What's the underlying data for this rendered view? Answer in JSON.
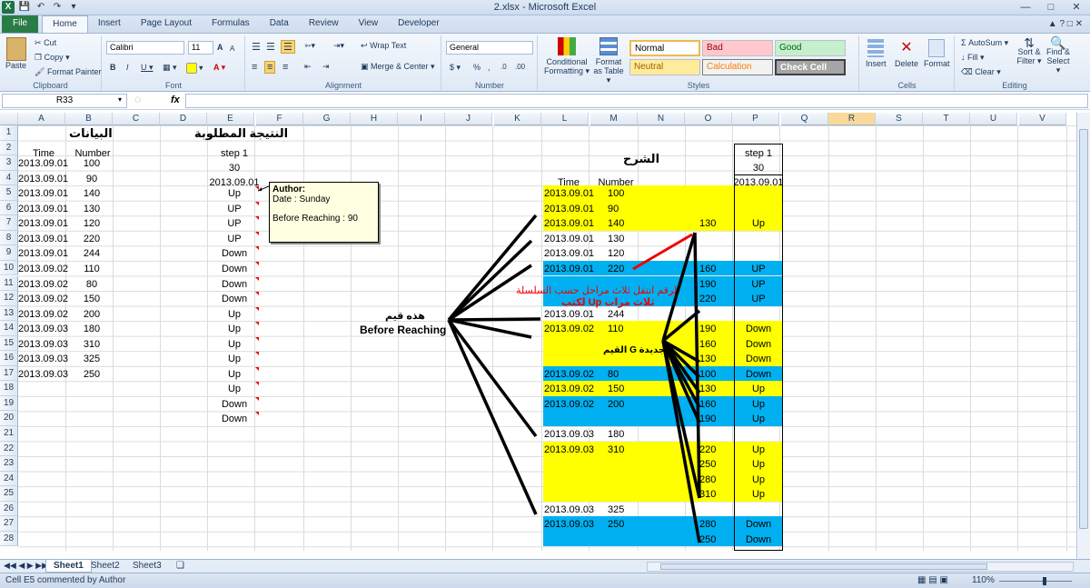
{
  "window": {
    "title": "2.xlsx  -  Microsoft Excel",
    "qat": [
      "X",
      "save",
      "undo",
      "redo",
      "▾"
    ]
  },
  "tabs": [
    "File",
    "Home",
    "Insert",
    "Page Layout",
    "Formulas",
    "Data",
    "Review",
    "View",
    "Developer"
  ],
  "ribbon": {
    "clipboard": {
      "paste": "Paste",
      "cut": "Cut",
      "copy": "Copy ▾",
      "format_painter": "Format Painter",
      "label": "Clipboard"
    },
    "font": {
      "name": "Calibri",
      "size": "11",
      "label": "Font",
      "bold": "B",
      "italic": "I",
      "underline": "U ▾",
      "grow": "A",
      "shrink": "A"
    },
    "alignment": {
      "wrap": "Wrap Text",
      "merge": "Merge & Center ▾",
      "label": "Alignment"
    },
    "number": {
      "format": "General",
      "label": "Number",
      "currency": "$ ▾",
      "percent": "%",
      "comma": ",",
      "inc_dec": ".0",
      "dec_dec": ".00"
    },
    "styles": {
      "conditional": "Conditional Formatting ▾",
      "format_table": "Format as Table ▾",
      "normal": "Normal",
      "bad": "Bad",
      "good": "Good",
      "neutral": "Neutral",
      "calculation": "Calculation",
      "check": "Check Cell",
      "label": "Styles"
    },
    "cells": {
      "insert": "Insert",
      "delete": "Delete",
      "format": "Format",
      "label": "Cells"
    },
    "editing": {
      "autosum": "AutoSum ▾",
      "fill": "Fill ▾",
      "clear": "Clear ▾",
      "sort": "Sort & Filter ▾",
      "find": "Find & Select ▾",
      "label": "Editing"
    }
  },
  "formula_bar": {
    "name_box": "R33",
    "fx": "fx",
    "value": ""
  },
  "columns": [
    "A",
    "B",
    "C",
    "D",
    "E",
    "F",
    "G",
    "H",
    "I",
    "J",
    "K",
    "L",
    "M",
    "N",
    "O",
    "P",
    "Q",
    "R",
    "S",
    "T",
    "U",
    "V"
  ],
  "selected_column": "R",
  "rows": [
    "1",
    "2",
    "3",
    "4",
    "5",
    "6",
    "7",
    "8",
    "9",
    "10",
    "11",
    "12",
    "13",
    "14",
    "15",
    "16",
    "17",
    "18",
    "19",
    "20",
    "21",
    "22",
    "23",
    "24",
    "25",
    "26",
    "27",
    "28"
  ],
  "left_table": {
    "title": "البيانات",
    "headers": [
      "Time",
      "Number"
    ],
    "rows": [
      [
        "2013.09.01",
        "100"
      ],
      [
        "2013.09.01",
        "90"
      ],
      [
        "2013.09.01",
        "140"
      ],
      [
        "2013.09.01",
        "130"
      ],
      [
        "2013.09.01",
        "120"
      ],
      [
        "2013.09.01",
        "220"
      ],
      [
        "2013.09.01",
        "244"
      ],
      [
        "2013.09.02",
        "110"
      ],
      [
        "2013.09.02",
        "80"
      ],
      [
        "2013.09.02",
        "150"
      ],
      [
        "2013.09.02",
        "200"
      ],
      [
        "2013.09.03",
        "180"
      ],
      [
        "2013.09.03",
        "310"
      ],
      [
        "2013.09.03",
        "325"
      ],
      [
        "2013.09.03",
        "250"
      ]
    ]
  },
  "result": {
    "title": "النتيجة المطلوبة",
    "step": "step 1",
    "value30": "30",
    "date": "2013.09.01",
    "values": [
      "Up",
      "UP",
      "UP",
      "UP",
      "Down",
      "Down",
      "Down",
      "Down",
      "Up",
      "Up",
      "Up",
      "Up",
      "Up",
      "Up",
      "Down",
      "Down"
    ]
  },
  "comment": {
    "author": "Author:",
    "date": "Date : Sunday",
    "before": "Before Reaching : 90"
  },
  "annotation": {
    "these": "هذه قيم",
    "before_reaching": "Before Reaching"
  },
  "explain": {
    "title": "الشرح",
    "headers": [
      "Time",
      "Number"
    ],
    "step": "step 1",
    "value30": "30",
    "date": "2013.09.01",
    "red_note1": "الرقم انتقل ثلاث مراحل حسب السلسلة",
    "red_note2": "لكتب Up ثلاث مرات",
    "g_note": "القيم G الجديدة",
    "rows": [
      {
        "time": "2013.09.01",
        "num": "100",
        "o": "",
        "p": "",
        "fill": "#ffff00"
      },
      {
        "time": "2013.09.01",
        "num": "90",
        "o": "",
        "p": "",
        "fill": "#ffff00"
      },
      {
        "time": "2013.09.01",
        "num": "140",
        "o": "130",
        "p": "Up",
        "fill": "#ffff00"
      },
      {
        "time": "2013.09.01",
        "num": "130",
        "o": "",
        "p": "",
        "fill": ""
      },
      {
        "time": "2013.09.01",
        "num": "120",
        "o": "",
        "p": "",
        "fill": ""
      },
      {
        "time": "2013.09.01",
        "num": "220",
        "o": "160",
        "p": "UP",
        "fill": "#00b0f0"
      },
      {
        "time": "",
        "num": "",
        "o": "190",
        "p": "UP",
        "fill": "#00b0f0"
      },
      {
        "time": "",
        "num": "",
        "o": "220",
        "p": "UP",
        "fill": "#00b0f0"
      },
      {
        "time": "2013.09.01",
        "num": "244",
        "o": "",
        "p": "",
        "fill": ""
      },
      {
        "time": "2013.09.02",
        "num": "110",
        "o": "190",
        "p": "Down",
        "fill": "#ffff00"
      },
      {
        "time": "",
        "num": "",
        "o": "160",
        "p": "Down",
        "fill": "#ffff00"
      },
      {
        "time": "",
        "num": "",
        "o": "130",
        "p": "Down",
        "fill": "#ffff00"
      },
      {
        "time": "2013.09.02",
        "num": "80",
        "o": "100",
        "p": "Down",
        "fill": "#00b0f0"
      },
      {
        "time": "2013.09.02",
        "num": "150",
        "o": "130",
        "p": "Up",
        "fill": "#ffff00"
      },
      {
        "time": "2013.09.02",
        "num": "200",
        "o": "160",
        "p": "Up",
        "fill": "#00b0f0"
      },
      {
        "time": "",
        "num": "",
        "o": "190",
        "p": "Up",
        "fill": "#00b0f0"
      },
      {
        "time": "2013.09.03",
        "num": "180",
        "o": "",
        "p": "",
        "fill": ""
      },
      {
        "time": "2013.09.03",
        "num": "310",
        "o": "220",
        "p": "Up",
        "fill": "#ffff00"
      },
      {
        "time": "",
        "num": "",
        "o": "250",
        "p": "Up",
        "fill": "#ffff00"
      },
      {
        "time": "",
        "num": "",
        "o": "280",
        "p": "Up",
        "fill": "#ffff00"
      },
      {
        "time": "",
        "num": "",
        "o": "310",
        "p": "Up",
        "fill": "#ffff00"
      },
      {
        "time": "2013.09.03",
        "num": "325",
        "o": "",
        "p": "",
        "fill": ""
      },
      {
        "time": "2013.09.03",
        "num": "250",
        "o": "280",
        "p": "Down",
        "fill": "#00b0f0"
      },
      {
        "time": "",
        "num": "",
        "o": "250",
        "p": "Down",
        "fill": "#00b0f0"
      }
    ]
  },
  "sheets": [
    "Sheet1",
    "Sheet2",
    "Sheet3"
  ],
  "status": {
    "text": "Cell E5 commented by Author",
    "zoom": "110%"
  },
  "colors": {
    "yellow": "#ffff00",
    "blue": "#00b0f0",
    "accent": "#1f7244"
  }
}
